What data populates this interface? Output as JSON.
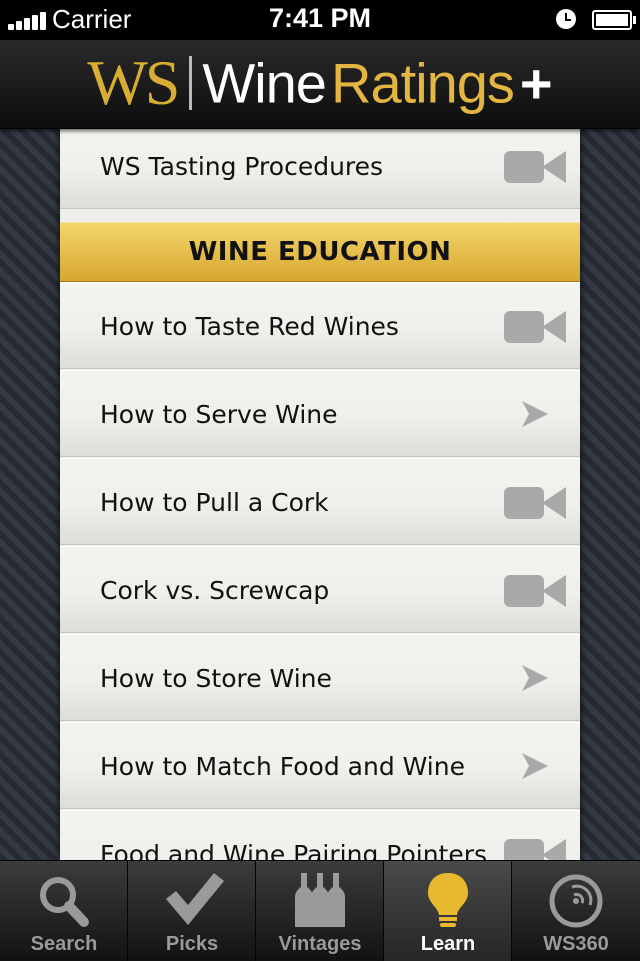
{
  "status_bar": {
    "carrier": "Carrier",
    "time": "7:41 PM"
  },
  "header": {
    "logo_ws": "WS",
    "logo_wine": "Wine",
    "logo_ratings": "Ratings",
    "logo_plus": "+"
  },
  "list": {
    "top_item": {
      "label": "WS Tasting Procedures",
      "icon": "video-icon"
    },
    "section_title": "WINE EDUCATION",
    "items": [
      {
        "label": "How to Taste Red Wines",
        "icon": "video-icon"
      },
      {
        "label": "How to Serve Wine",
        "icon": "chevron-icon"
      },
      {
        "label": "How to Pull a Cork",
        "icon": "video-icon"
      },
      {
        "label": "Cork vs. Screwcap",
        "icon": "video-icon"
      },
      {
        "label": "How to Store Wine",
        "icon": "chevron-icon"
      },
      {
        "label": "How to Match Food and Wine",
        "icon": "chevron-icon"
      },
      {
        "label": "Food and Wine Pairing Pointers",
        "icon": "video-icon"
      }
    ]
  },
  "tab_bar": {
    "active_tab": "Learn",
    "tabs": [
      {
        "label": "Search",
        "icon": "magnifier-icon"
      },
      {
        "label": "Picks",
        "icon": "checkmark-icon"
      },
      {
        "label": "Vintages",
        "icon": "bottles-icon"
      },
      {
        "label": "Learn",
        "icon": "lightbulb-icon"
      },
      {
        "label": "WS360",
        "icon": "ws360-icon"
      }
    ]
  },
  "colors": {
    "accent_gold": "#e2b640",
    "section_gold": "#e9c24c",
    "list_bg": "#efefeb"
  }
}
